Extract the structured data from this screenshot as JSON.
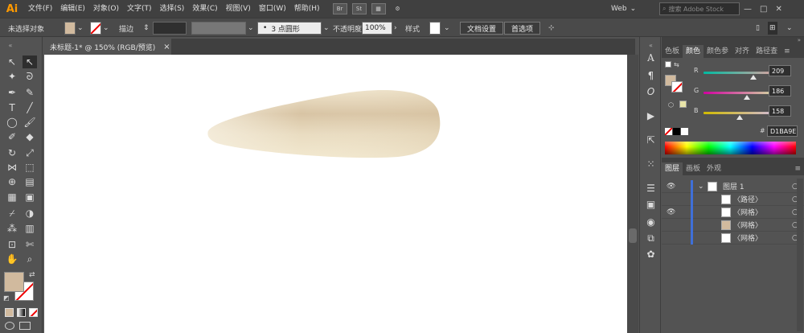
{
  "app": {
    "logo": "Ai"
  },
  "menu": [
    {
      "label": "文件(F)"
    },
    {
      "label": "编辑(E)"
    },
    {
      "label": "对象(O)"
    },
    {
      "label": "文字(T)"
    },
    {
      "label": "选择(S)"
    },
    {
      "label": "效果(C)"
    },
    {
      "label": "视图(V)"
    },
    {
      "label": "窗口(W)"
    },
    {
      "label": "帮助(H)"
    }
  ],
  "menubar_icons": [
    "Br",
    "St"
  ],
  "workspace": {
    "label": "Web"
  },
  "search": {
    "placeholder": "搜索 Adobe Stock"
  },
  "control": {
    "selection": "未选择对象",
    "stroke_label": "描边",
    "brush_value": "3 点圆形",
    "opacity_label": "不透明度",
    "opacity_value": "100%",
    "style_label": "样式",
    "doc_setup": "文档设置",
    "prefs": "首选项"
  },
  "document_tab": {
    "title": "未标题-1* @ 150% (RGB/预览)",
    "close": "×"
  },
  "colors": {
    "fill": "#D1BA9E",
    "shape_light": "#f3ecd8",
    "shape_mid": "#e6d4b6",
    "shape_dark": "#d9c3a0"
  },
  "color_panel": {
    "tabs": [
      {
        "label": "色板"
      },
      {
        "label": "颜色"
      },
      {
        "label": "颜色参"
      },
      {
        "label": "对齐"
      },
      {
        "label": "路径查"
      }
    ],
    "channels": [
      {
        "name": "R",
        "value": "209",
        "level": 0.82
      },
      {
        "name": "G",
        "value": "186",
        "level": 0.73
      },
      {
        "name": "B",
        "value": "158",
        "level": 0.62
      }
    ],
    "hex": "D1BA9E"
  },
  "layers_panel": {
    "tabs": [
      {
        "label": "图层"
      },
      {
        "label": "画板"
      },
      {
        "label": "外观"
      }
    ],
    "layer_name": "图层 1",
    "items": [
      {
        "label": "〈路径〉"
      },
      {
        "label": "〈网格〉"
      },
      {
        "label": "〈网格〉"
      },
      {
        "label": "〈网格〉"
      }
    ]
  }
}
